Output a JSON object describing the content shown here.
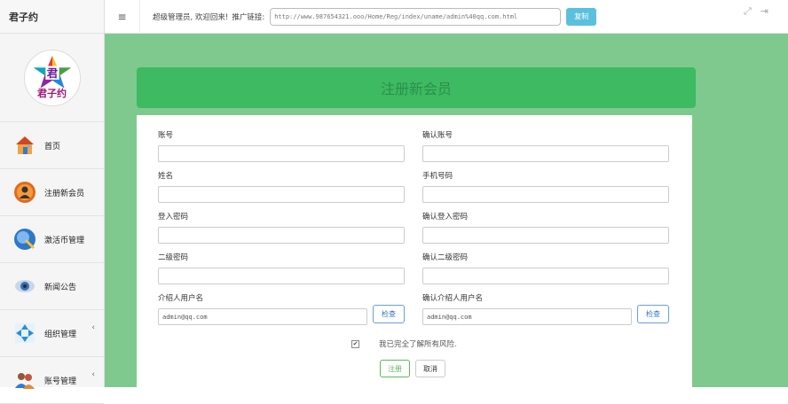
{
  "brand": {
    "name": "君子约"
  },
  "logo": {
    "text": "君子约",
    "center_char": "君"
  },
  "sidebar": {
    "items": [
      {
        "label": "首页",
        "icon": "house-icon",
        "color": "#e87c2a",
        "has_submenu": false
      },
      {
        "label": "注册新会员",
        "icon": "user-add-icon",
        "color": "#e26a1b",
        "has_submenu": false
      },
      {
        "label": "激活币管理",
        "icon": "wand-icon",
        "color": "#2f77c7",
        "has_submenu": false
      },
      {
        "label": "新闻公告",
        "icon": "eye-icon",
        "color": "#3b6fae",
        "has_submenu": false
      },
      {
        "label": "组织管理",
        "icon": "network-icon",
        "color": "#2a8fd0",
        "has_submenu": true
      },
      {
        "label": "账号管理",
        "icon": "users-icon",
        "color": "#c4553a",
        "has_submenu": true
      }
    ],
    "submenu_caret": "‹"
  },
  "topbar": {
    "menu_icon": "≡",
    "welcome": "超级管理员, 欢迎回来!",
    "promo_label": "推广链接:",
    "promo_url": "http://www.987654321.ooo/Home/Reg/index/uname/admin%40qq.com.html",
    "copy_label": "复制",
    "expand_icon": "⤢",
    "logout_icon": "⇥"
  },
  "page": {
    "title": "注册新会员"
  },
  "form": {
    "account": {
      "label": "账号",
      "value": ""
    },
    "confirm_account": {
      "label": "确认账号",
      "value": ""
    },
    "name": {
      "label": "姓名",
      "value": ""
    },
    "phone": {
      "label": "手机号码",
      "value": ""
    },
    "login_password": {
      "label": "登入密码",
      "value": ""
    },
    "confirm_login_password": {
      "label": "确认登入密码",
      "value": ""
    },
    "second_password": {
      "label": "二级密码",
      "value": ""
    },
    "confirm_second_password": {
      "label": "确认二级密码",
      "value": ""
    },
    "referrer": {
      "label": "介绍人用户名",
      "value": "admin@qq.com"
    },
    "confirm_referrer": {
      "label": "确认介绍人用户名",
      "value": "admin@qq.com"
    },
    "check_label": "检查",
    "agree_text": "我已完全了解所有风险.",
    "agree_checked": true,
    "checkmark": "✔",
    "submit_label": "注册",
    "cancel_label": "取消"
  },
  "colors": {
    "content_bg": "#7fc98f",
    "title_bar": "#3dba62",
    "copy_button": "#5bc0de",
    "submit": "#5cb85c"
  }
}
